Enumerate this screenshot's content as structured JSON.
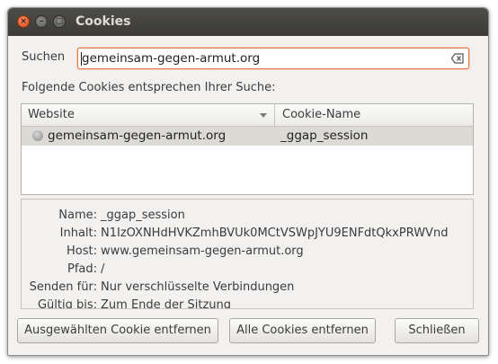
{
  "window": {
    "title": "Cookies"
  },
  "search": {
    "label": "Suchen",
    "value": "gemeinsam-gegen-armut.org"
  },
  "results_label": "Folgende Cookies entsprechen Ihrer Suche:",
  "list": {
    "columns": [
      "Website",
      "Cookie-Name"
    ],
    "rows": [
      {
        "site": "gemeinsam-gegen-armut.org",
        "name": "_ggap_session"
      }
    ]
  },
  "details": {
    "name_label": "Name:",
    "name_value": "_ggap_session",
    "content_label": "Inhalt:",
    "content_value": "N1IzOXNHdHVKZmhBVUk0MCtVSWpJYU9ENFdtQkxPRWVnd",
    "host_label": "Host:",
    "host_value": "www.gemeinsam-gegen-armut.org",
    "path_label": "Pfad:",
    "path_value": "/",
    "send_label": "Senden für:",
    "send_value": "Nur verschlüsselte Verbindungen",
    "expires_label": "Gültig bis:",
    "expires_value": "Zum Ende der Sitzung"
  },
  "buttons": {
    "remove_selected": "Ausgewählten Cookie entfernen",
    "remove_all": "Alle Cookies entfernen",
    "close": "Schließen"
  }
}
